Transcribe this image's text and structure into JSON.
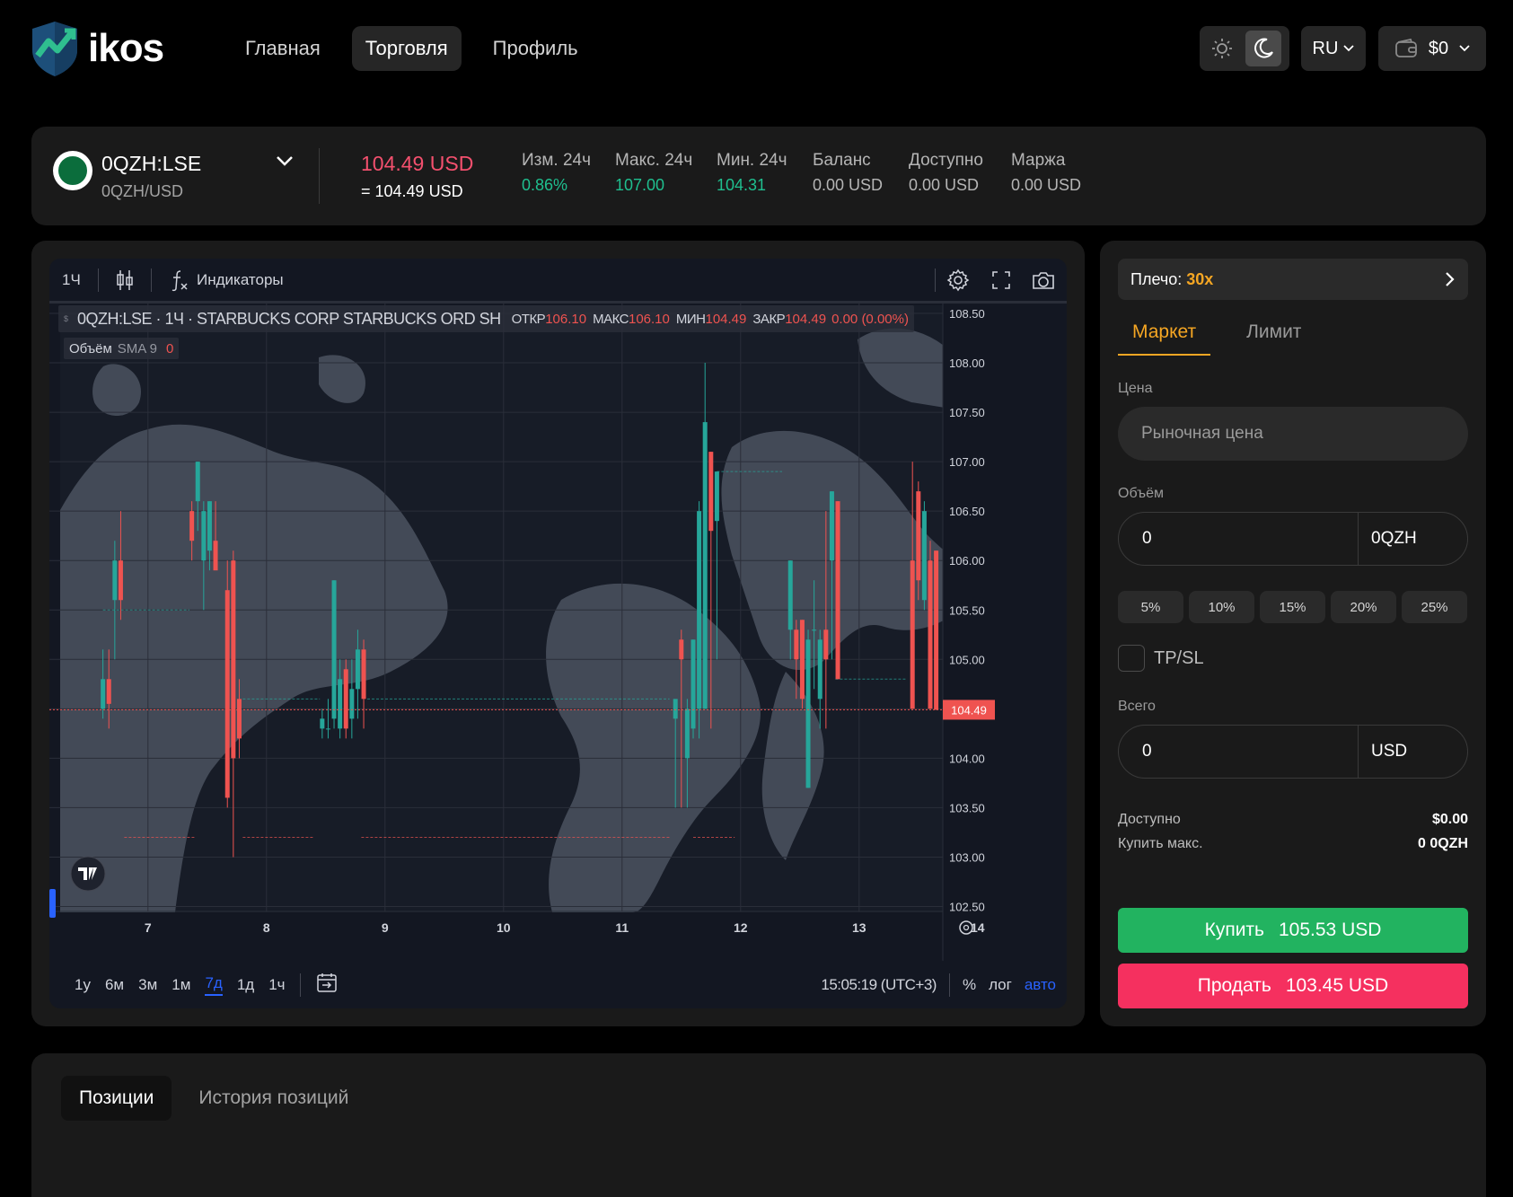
{
  "header": {
    "logo_text": "ikos",
    "nav": [
      "Главная",
      "Торговля",
      "Профиль"
    ],
    "active_nav": "Торговля",
    "language": "RU",
    "wallet_balance": "$0"
  },
  "ticker": {
    "symbol": "0QZH:LSE",
    "pair": "0QZH/USD",
    "price": "104.49 USD",
    "price_equiv": "= 104.49 USD",
    "stats": [
      {
        "label": "Изм. 24ч",
        "value": "0.86%",
        "tone": "green"
      },
      {
        "label": "Макс. 24ч",
        "value": "107.00",
        "tone": "green"
      },
      {
        "label": "Мин. 24ч",
        "value": "104.31",
        "tone": "green"
      },
      {
        "label": "Баланс",
        "value": "0.00 USD",
        "tone": "muted"
      },
      {
        "label": "Доступно",
        "value": "0.00 USD",
        "tone": "muted"
      },
      {
        "label": "Маржа",
        "value": "0.00 USD",
        "tone": "muted"
      }
    ]
  },
  "chart_toolbar": {
    "interval": "1Ч",
    "indicators": "Индикаторы"
  },
  "chart_legend": {
    "title": "0QZH:LSE · 1Ч · STARBUCKS CORP STARBUCKS ORD SH",
    "open_label": "ОТКР",
    "open": "106.10",
    "high_label": "МАКС",
    "high": "106.10",
    "low_label": "МИН",
    "low": "104.49",
    "close_label": "ЗАКР",
    "close": "104.49",
    "change": "0.00 (0.00%)",
    "volume_label": "Объём",
    "sma_label": "SMA 9",
    "volume_value": "0"
  },
  "chart_bottom": {
    "ranges": [
      "1у",
      "6м",
      "3м",
      "1м",
      "7д",
      "1д",
      "1ч"
    ],
    "active_range": "7д",
    "time": "15:05:19 (UTC+3)",
    "percent": "%",
    "log": "лог",
    "auto": "авто"
  },
  "chart_data": {
    "type": "candlestick",
    "title": "0QZH:LSE · 1Ч · STARBUCKS CORP STARBUCKS ORD SH",
    "x_ticks": [
      "7",
      "8",
      "9",
      "10",
      "11",
      "12",
      "13",
      "14"
    ],
    "y_ticks": [
      "108.50",
      "108.00",
      "107.50",
      "107.00",
      "106.50",
      "106.00",
      "105.50",
      "105.00",
      "104.50",
      "104.00",
      "103.50",
      "103.00",
      "102.50"
    ],
    "ylim": [
      102.45,
      108.6
    ],
    "last_price": "104.49",
    "up_color": "#26a69a",
    "down_color": "#ef5350",
    "candles": [
      {
        "x": 6.62,
        "o": 104.5,
        "h": 105.1,
        "l": 104.4,
        "c": 104.8
      },
      {
        "x": 6.67,
        "o": 104.8,
        "h": 105.1,
        "l": 104.3,
        "c": 104.55
      },
      {
        "x": 6.72,
        "o": 105.6,
        "h": 106.2,
        "l": 105.0,
        "c": 106.0
      },
      {
        "x": 6.77,
        "o": 106.0,
        "h": 106.5,
        "l": 105.4,
        "c": 105.6
      },
      {
        "x": 7.37,
        "o": 106.5,
        "h": 106.6,
        "l": 106.0,
        "c": 106.2
      },
      {
        "x": 7.42,
        "o": 106.6,
        "h": 107.0,
        "l": 106.3,
        "c": 107.0
      },
      {
        "x": 7.47,
        "o": 106.0,
        "h": 106.6,
        "l": 105.5,
        "c": 106.5
      },
      {
        "x": 7.52,
        "o": 106.1,
        "h": 106.6,
        "l": 105.9,
        "c": 106.6
      },
      {
        "x": 7.57,
        "o": 106.2,
        "h": 106.6,
        "l": 106.0,
        "c": 105.9
      },
      {
        "x": 7.67,
        "o": 105.7,
        "h": 106.0,
        "l": 103.5,
        "c": 103.6
      },
      {
        "x": 7.72,
        "o": 106.0,
        "h": 106.1,
        "l": 103.0,
        "c": 104.0
      },
      {
        "x": 7.77,
        "o": 104.6,
        "h": 104.8,
        "l": 104.0,
        "c": 104.2
      },
      {
        "x": 8.47,
        "o": 104.3,
        "h": 104.5,
        "l": 104.2,
        "c": 104.4
      },
      {
        "x": 8.52,
        "o": 104.3,
        "h": 104.6,
        "l": 104.2,
        "c": 104.3
      },
      {
        "x": 8.57,
        "o": 104.4,
        "h": 105.8,
        "l": 104.3,
        "c": 105.8
      },
      {
        "x": 8.62,
        "o": 104.3,
        "h": 105.0,
        "l": 104.2,
        "c": 104.8
      },
      {
        "x": 8.67,
        "o": 104.9,
        "h": 105.0,
        "l": 104.2,
        "c": 104.3
      },
      {
        "x": 8.72,
        "o": 104.4,
        "h": 105.0,
        "l": 104.2,
        "c": 104.7
      },
      {
        "x": 8.77,
        "o": 104.7,
        "h": 105.3,
        "l": 104.4,
        "c": 105.1
      },
      {
        "x": 8.82,
        "o": 105.1,
        "h": 105.2,
        "l": 104.3,
        "c": 104.6
      },
      {
        "x": 11.45,
        "o": 104.4,
        "h": 104.5,
        "l": 103.5,
        "c": 104.6
      },
      {
        "x": 11.5,
        "o": 105.2,
        "h": 105.3,
        "l": 103.5,
        "c": 105.0
      },
      {
        "x": 11.55,
        "o": 104.0,
        "h": 104.6,
        "l": 103.5,
        "c": 104.5
      },
      {
        "x": 11.6,
        "o": 104.3,
        "h": 105.2,
        "l": 104.2,
        "c": 105.2
      },
      {
        "x": 11.65,
        "o": 104.5,
        "h": 106.6,
        "l": 104.2,
        "c": 106.5
      },
      {
        "x": 11.7,
        "o": 104.5,
        "h": 108.0,
        "l": 104.5,
        "c": 107.4
      },
      {
        "x": 11.75,
        "o": 107.1,
        "h": 107.1,
        "l": 104.3,
        "c": 106.3
      },
      {
        "x": 11.8,
        "o": 106.4,
        "h": 106.9,
        "l": 105.0,
        "c": 106.9
      },
      {
        "x": 12.42,
        "o": 105.3,
        "h": 106.0,
        "l": 105.0,
        "c": 106.0
      },
      {
        "x": 12.47,
        "o": 105.3,
        "h": 105.4,
        "l": 104.6,
        "c": 105.0
      },
      {
        "x": 12.52,
        "o": 105.4,
        "h": 105.4,
        "l": 104.5,
        "c": 104.6
      },
      {
        "x": 12.57,
        "o": 103.7,
        "h": 105.3,
        "l": 103.7,
        "c": 105.2
      },
      {
        "x": 12.62,
        "o": 105.3,
        "h": 105.8,
        "l": 104.7,
        "c": 105.3
      },
      {
        "x": 12.67,
        "o": 104.6,
        "h": 105.3,
        "l": 104.3,
        "c": 105.2
      },
      {
        "x": 12.72,
        "o": 105.3,
        "h": 106.5,
        "l": 104.3,
        "c": 105.0
      },
      {
        "x": 12.77,
        "o": 106.0,
        "h": 106.7,
        "l": 105.0,
        "c": 106.7
      },
      {
        "x": 12.82,
        "o": 106.6,
        "h": 106.6,
        "l": 104.8,
        "c": 104.8
      },
      {
        "x": 13.45,
        "o": 106.0,
        "h": 107.0,
        "l": 104.5,
        "c": 104.5
      },
      {
        "x": 13.5,
        "o": 106.7,
        "h": 106.8,
        "l": 105.6,
        "c": 105.8
      },
      {
        "x": 13.55,
        "o": 105.6,
        "h": 106.6,
        "l": 105.5,
        "c": 106.5
      },
      {
        "x": 13.6,
        "o": 106.0,
        "h": 106.2,
        "l": 104.5,
        "c": 104.5
      },
      {
        "x": 13.65,
        "o": 106.1,
        "h": 106.1,
        "l": 104.49,
        "c": 104.49
      }
    ]
  },
  "order": {
    "leverage_label": "Плечо:",
    "leverage_value": "30x",
    "tabs": [
      "Маркет",
      "Лимит"
    ],
    "active_tab": "Маркет",
    "price_label": "Цена",
    "price_placeholder": "Рыночная цена",
    "volume_label": "Объём",
    "volume_value": "0",
    "volume_unit": "0QZH",
    "percents": [
      "5%",
      "10%",
      "15%",
      "20%",
      "25%"
    ],
    "tpsl_label": "TP/SL",
    "total_label": "Всего",
    "total_value": "0",
    "total_unit": "USD",
    "available_label": "Доступно",
    "available_value": "$0.00",
    "max_buy_label": "Купить макс.",
    "max_buy_value": "0 0QZH",
    "buy_label": "Купить",
    "buy_price": "105.53 USD",
    "sell_label": "Продать",
    "sell_price": "103.45 USD"
  },
  "positions": {
    "tabs": [
      "Позиции",
      "История позиций"
    ],
    "active_tab": "Позиции"
  },
  "colors": {
    "accent": "#f5a623",
    "buy": "#22b360",
    "sell": "#f5305f",
    "price_red": "#f4506e",
    "stat_green": "#1fbf8f"
  }
}
